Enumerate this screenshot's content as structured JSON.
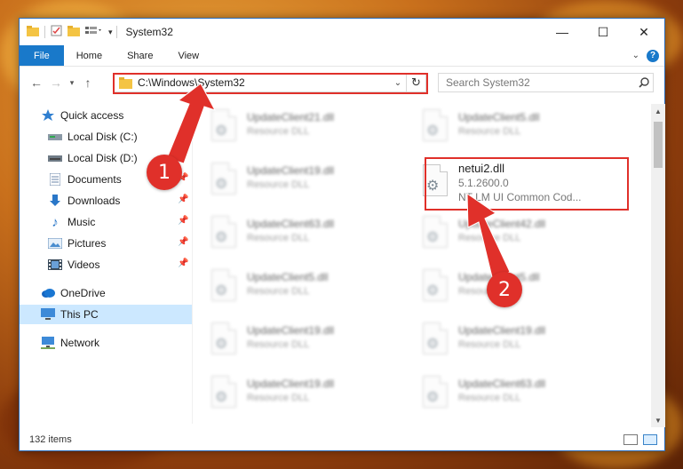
{
  "window": {
    "title": "System32",
    "controls": {
      "minimize": "—",
      "maximize": "☐",
      "close": "✕"
    }
  },
  "ribbon": {
    "tabs": [
      "File",
      "Home",
      "Share",
      "View"
    ]
  },
  "address": {
    "path": "C:\\Windows\\System32",
    "search_placeholder": "Search System32"
  },
  "sidebar": {
    "quick_access": "Quick access",
    "items": [
      {
        "label": "Local Disk (C:)",
        "icon": "drive-icon",
        "pinned": false
      },
      {
        "label": "Local Disk (D:)",
        "icon": "drive-icon",
        "pinned": true
      },
      {
        "label": "Documents",
        "icon": "documents-icon",
        "pinned": true
      },
      {
        "label": "Downloads",
        "icon": "downloads-icon",
        "pinned": true
      },
      {
        "label": "Music",
        "icon": "music-icon",
        "pinned": true
      },
      {
        "label": "Pictures",
        "icon": "pictures-icon",
        "pinned": true
      },
      {
        "label": "Videos",
        "icon": "videos-icon",
        "pinned": true
      }
    ],
    "onedrive": "OneDrive",
    "this_pc": "This PC",
    "network": "Network"
  },
  "files": {
    "left": [
      {
        "name": "UpdateClient21.dll",
        "desc": "Resource DLL"
      },
      {
        "name": "UpdateClient19.dll",
        "desc": "Resource DLL"
      },
      {
        "name": "UpdateClient63.dll",
        "desc": "Resource DLL"
      },
      {
        "name": "UpdateClient5.dll",
        "desc": "Resource DLL"
      },
      {
        "name": "UpdateClient19.dll",
        "desc": "Resource DLL"
      },
      {
        "name": "UpdateClient19.dll",
        "desc": "Resource DLL"
      }
    ],
    "right": [
      {
        "name": "UpdateClient5.dll",
        "desc": "Resource DLL"
      },
      {
        "name": "UpdateClient42.dll",
        "desc": "Resource DLL"
      },
      {
        "name": "UpdateClient5.dll",
        "desc": "Resource DLL"
      },
      {
        "name": "UpdateClient19.dll",
        "desc": "Resource DLL"
      },
      {
        "name": "UpdateClient63.dll",
        "desc": "Resource DLL"
      }
    ],
    "highlighted": {
      "name": "netui2.dll",
      "version": "5.1.2600.0",
      "desc": "NT LM UI Common Cod..."
    }
  },
  "status": {
    "item_count": "132 items"
  },
  "callouts": [
    "1",
    "2"
  ],
  "colors": {
    "accent": "#1979ca",
    "highlight_red": "#e0302a"
  }
}
